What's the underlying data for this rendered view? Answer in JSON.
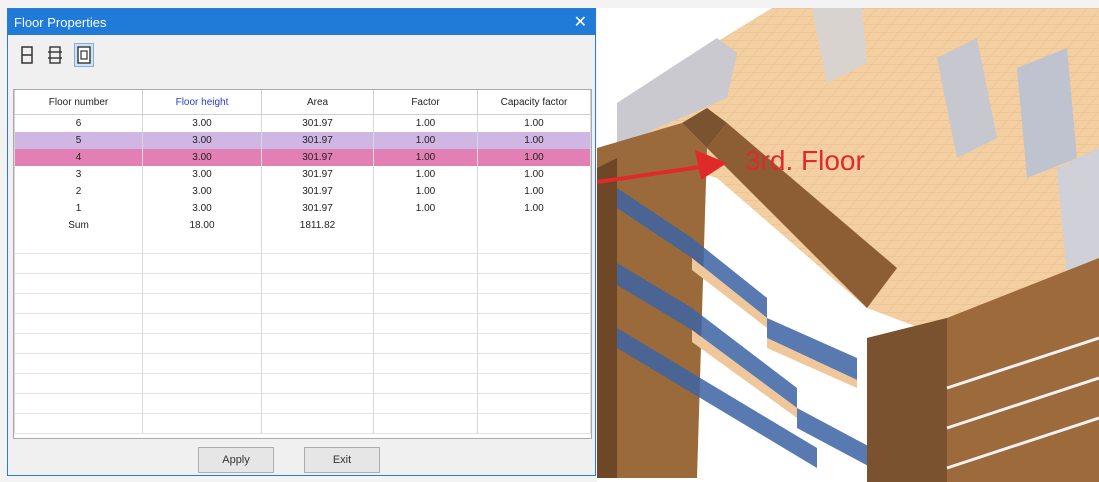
{
  "dialog": {
    "title": "Floor Properties",
    "close_glyph": "✕",
    "toolbar": [
      "floor-single-icon",
      "floor-multi-icon",
      "floor-page-icon"
    ]
  },
  "table": {
    "headers": [
      "Floor number",
      "Floor height",
      "Area",
      "Factor",
      "Capacity factor"
    ],
    "rows": [
      [
        "6",
        "3.00",
        "301.97",
        "1.00",
        "1.00"
      ],
      [
        "5",
        "3.00",
        "301.97",
        "1.00",
        "1.00"
      ],
      [
        "4",
        "3.00",
        "301.97",
        "1.00",
        "1.00"
      ],
      [
        "3",
        "3.00",
        "301.97",
        "1.00",
        "1.00"
      ],
      [
        "2",
        "3.00",
        "301.97",
        "1.00",
        "1.00"
      ],
      [
        "1",
        "3.00",
        "301.97",
        "1.00",
        "1.00"
      ],
      [
        "Sum",
        "18.00",
        "1811.82",
        "",
        ""
      ]
    ]
  },
  "buttons": {
    "apply": "Apply",
    "exit": "Exit"
  },
  "annotation": "3rd. Floor",
  "colors": {
    "title_bar": "#1f7ad8",
    "row_5": "#cfb6e3",
    "row_4": "#e27fb4",
    "arrow": "#e02a2a"
  }
}
